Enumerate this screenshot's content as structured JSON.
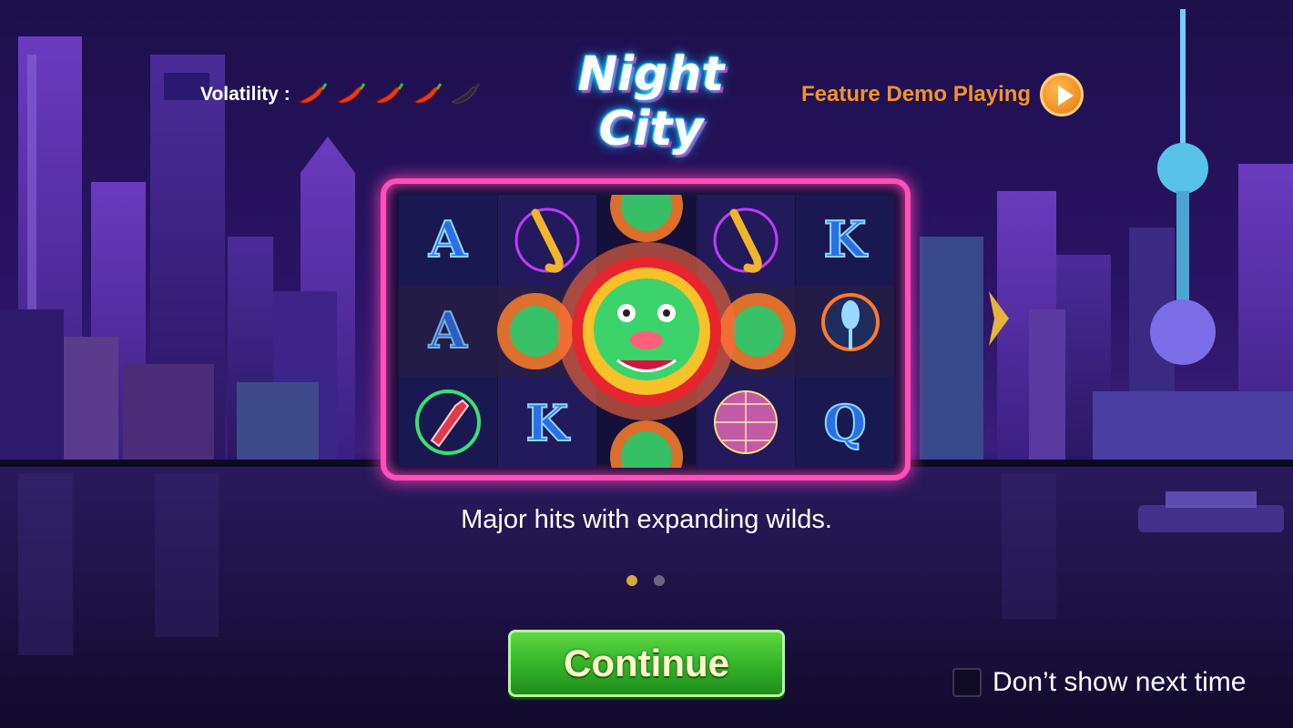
{
  "game": {
    "title": "Night City",
    "volatility": {
      "label": "Volatility :",
      "level": 4,
      "max": 5,
      "icon": "chili-pepper-icon"
    },
    "feature_demo": {
      "label": "Feature Demo Playing",
      "icon": "play-icon"
    }
  },
  "reels": {
    "symbols": [
      [
        "A",
        "saxophone",
        "dragon-wild",
        "saxophone",
        "K"
      ],
      [
        "A",
        "dragon-wild",
        "dragon-wild",
        "dragon-wild",
        "microphone"
      ],
      [
        "bottle",
        "K",
        "dragon-wild",
        "disco-ball",
        "Q"
      ]
    ]
  },
  "slide": {
    "caption": "Major hits with expanding wilds.",
    "pages": 2,
    "current": 1
  },
  "actions": {
    "continue_label": "Continue",
    "dont_show_label": "Don’t show next time",
    "dont_show_checked": false
  },
  "colors": {
    "accent_orange": "#f3932a",
    "neon_pink": "#ff4fb8",
    "button_green": "#35b52a",
    "dot_active": "#d9a63a",
    "dot_inactive": "#6b6480"
  }
}
